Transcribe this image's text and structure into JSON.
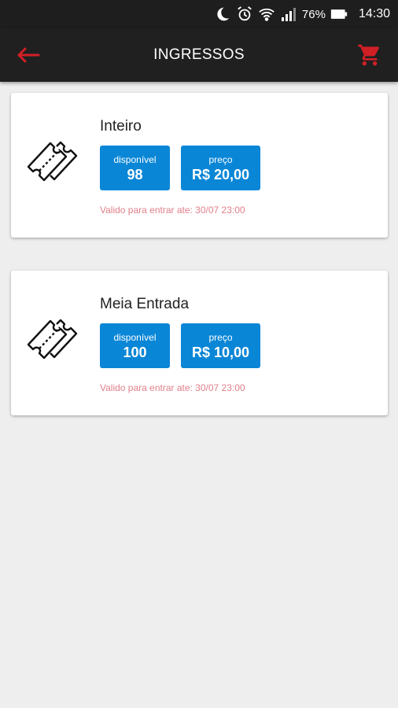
{
  "status_bar": {
    "battery": "76%",
    "time": "14:30",
    "icons": [
      "moon-icon",
      "alarm-icon",
      "wifi-icon",
      "signal-icon",
      "battery-icon"
    ]
  },
  "appbar": {
    "title": "INGRESSOS",
    "back_icon": "arrow-left-icon",
    "cart_icon": "shopping-cart-icon",
    "accent": "#d11f26"
  },
  "tickets": [
    {
      "name": "Inteiro",
      "available_label": "disponível",
      "available": "98",
      "price_label": "preço",
      "price": "R$ 20,00",
      "validity": "Valido para entrar ate: 30/07 23:00"
    },
    {
      "name": "Meia Entrada",
      "available_label": "disponível",
      "available": "100",
      "price_label": "preço",
      "price": "R$ 10,00",
      "validity": "Valido para entrar ate: 30/07 23:00"
    }
  ],
  "colors": {
    "box": "#0a86d6",
    "validity_text": "#e07f8a",
    "background": "#eeeeee"
  }
}
